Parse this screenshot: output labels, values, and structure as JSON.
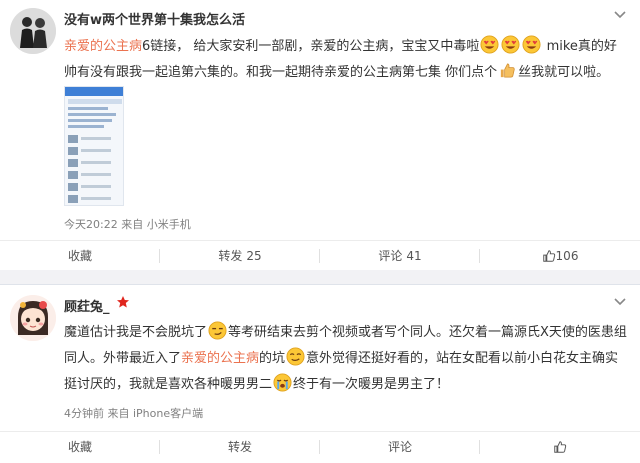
{
  "post1": {
    "username": "没有w两个世界第十集我怎么活",
    "text": {
      "link1": "亲爱的公主病",
      "t1": "6链接， 给大家安利一部剧，亲爱的公主病，宝宝又中毒啦",
      "t2": "mike真的好帅有没有跟我一起追第六集的。和我一起期待亲爱的公主病第七集 你们点个",
      "t3": "丝我就可以啦。"
    },
    "meta": "今天20:22 来自 小米手机",
    "actions": {
      "collect": "收藏",
      "repost": "转发",
      "repost_count": "25",
      "comment": "评论",
      "comment_count": "41",
      "like_count": "106"
    }
  },
  "post2": {
    "username": "顾荭兔_",
    "text": {
      "t1": "魔道估计我是不会脱坑了",
      "t2": "等考研结束去剪个视频或者写个同人。还欠着一篇源氏X天使的医患组同人。外带最近入了",
      "link1": "亲爱的公主病",
      "t3": "的坑",
      "t4": "意外觉得还挺好看的，站在女配看以前小白花女主确实挺讨厌的，我就是喜欢各种暖男男二",
      "t5": "终于有一次暖男是男主了！"
    },
    "meta": "4分钟前 来自 iPhone客户端",
    "actions": {
      "collect": "收藏",
      "repost": "转发",
      "comment": "评论"
    }
  },
  "colors": {
    "link": "#eb7350",
    "badge": "#e0261e",
    "separator": "#f2f2f5"
  },
  "icons": [
    "chevron-down-icon",
    "heart-eyes-emoji-icon",
    "thumbs-up-emoji-icon",
    "smirk-emoji-icon",
    "crying-emoji-icon",
    "like-icon",
    "crown-badge-icon"
  ]
}
